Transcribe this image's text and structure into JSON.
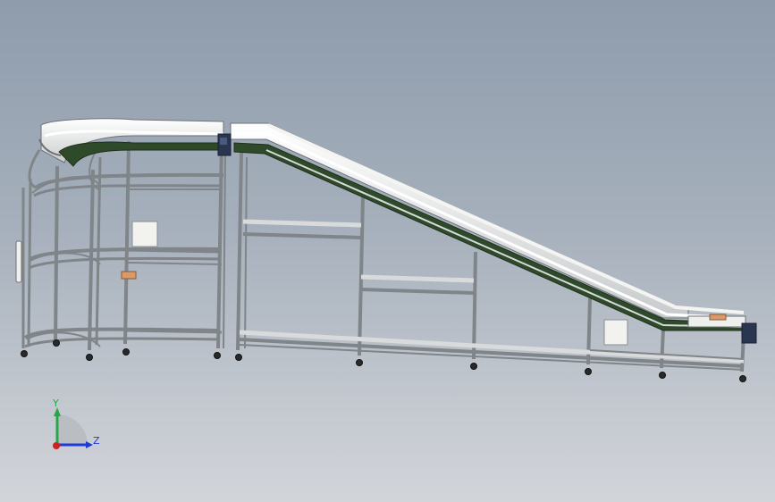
{
  "viewport": {
    "background_top": "#8e9cac",
    "background_bottom": "#d2d5da"
  },
  "model": {
    "frame_color": "#7f8589",
    "rail_color": "#ececea",
    "belt_color": "#2f4a2a",
    "plate_color": "#f2f2ee",
    "bracket_color": "#d99a6a",
    "motor_color": "#2a3550"
  },
  "triad": {
    "y_label": "Y",
    "z_label": "Z",
    "y_color": "#2aa64a",
    "z_color": "#1f3bd6",
    "x_color": "#d12020"
  }
}
